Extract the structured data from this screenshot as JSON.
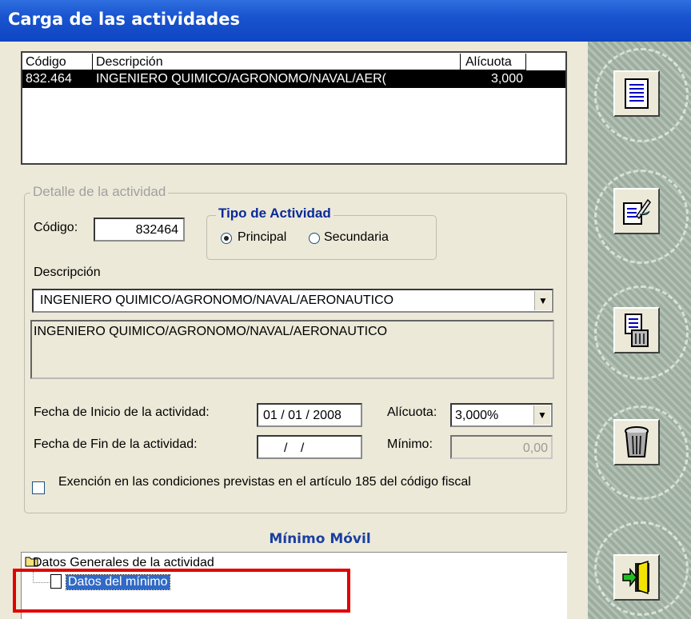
{
  "window": {
    "title": "Carga de las actividades"
  },
  "activity_list": {
    "headers": [
      "Código",
      "Descripción",
      "Alícuota"
    ],
    "rows": [
      {
        "code": "832.464",
        "description": "INGENIERO QUIMICO/AGRONOMO/NAVAL/AER(",
        "rate": "3,000"
      }
    ]
  },
  "detail": {
    "legend": "Detalle de la actividad",
    "code_label": "Código:",
    "code_value": "832464",
    "tipo": {
      "legend": "Tipo de Actividad",
      "principal": "Principal",
      "secundaria": "Secundaria",
      "selected": "Principal"
    },
    "desc_label": "Descripción",
    "desc_select": "INGENIERO QUIMICO/AGRONOMO/NAVAL/AERONAUTICO",
    "desc_text": "INGENIERO QUIMICO/AGRONOMO/NAVAL/AERONAUTICO",
    "start_label": "Fecha de Inicio de la actividad:",
    "start_value": "01 / 01 / 2008",
    "end_label": "Fecha de Fin de la actividad:",
    "end_value": "/ /",
    "alicuota_label": "Alícuota:",
    "alicuota_value": "3,000%",
    "minimo_label": "Mínimo:",
    "minimo_value": "0,00",
    "exencion_label": "Exención en las condiciones previstas en el artículo 185 del código fiscal"
  },
  "minimo_movil": {
    "title": "Mínimo Móvil",
    "tree": [
      {
        "label": "Datos Generales de la actividad"
      },
      {
        "label": "Datos del mínimo",
        "selected": true
      }
    ]
  },
  "sidebar_icons": [
    "document-list-icon",
    "edit-document-icon",
    "delete-document-icon",
    "trash-icon",
    "exit-door-icon"
  ],
  "colors": {
    "title_bar": "#1a54cf",
    "highlight": "#e00000",
    "selection": "#316ac5"
  }
}
